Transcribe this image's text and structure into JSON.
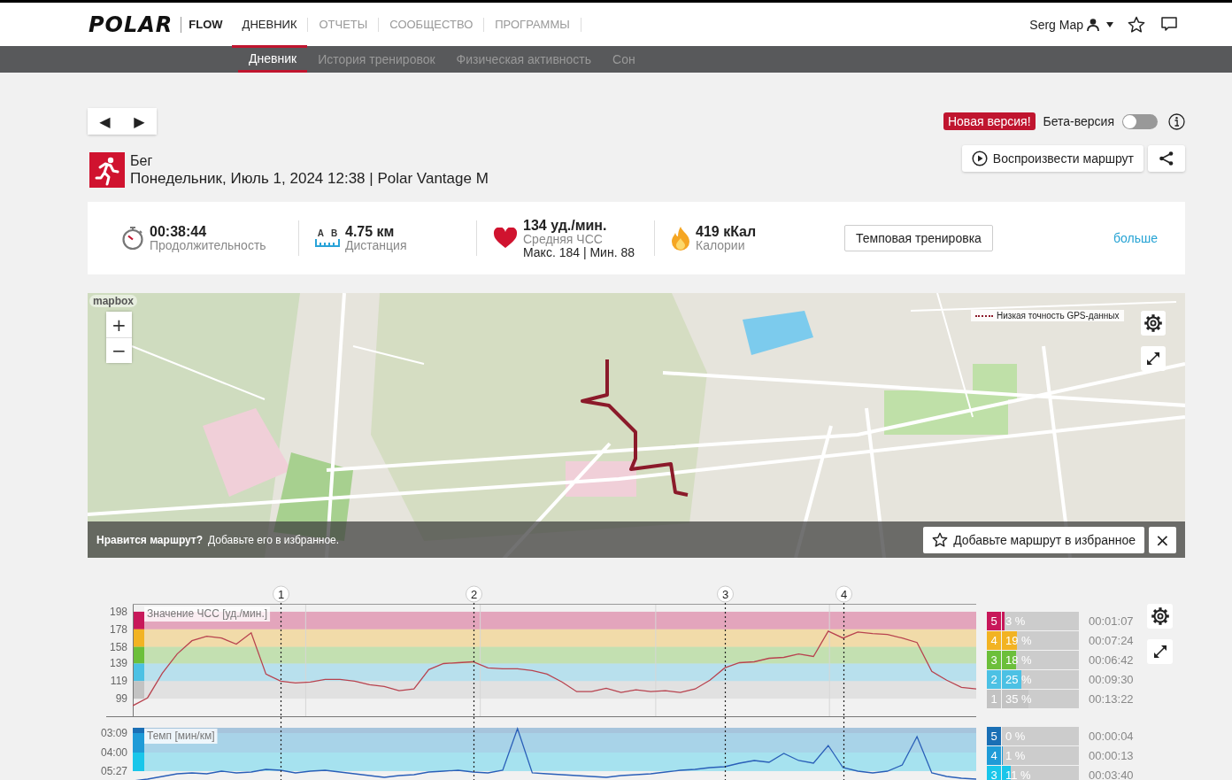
{
  "header": {
    "logo": "POLAR",
    "product": "FLOW",
    "nav": [
      {
        "label": "ДНЕВНИК",
        "selected": true
      },
      {
        "label": "ОТЧЕТЫ",
        "selected": false
      },
      {
        "label": "СООБЩЕСТВО",
        "selected": false
      },
      {
        "label": "ПРОГРАММЫ",
        "selected": false
      }
    ],
    "user": "Serg Map"
  },
  "subnav": [
    {
      "label": "Дневник",
      "selected": true
    },
    {
      "label": "История тренировок",
      "selected": false
    },
    {
      "label": "Физическая активность",
      "selected": false
    },
    {
      "label": "Сон",
      "selected": false
    }
  ],
  "toolbar": {
    "prev": "◀",
    "next": "▶",
    "badge": "Новая версия!",
    "beta": {
      "label": "Бета-версия",
      "on": false
    }
  },
  "activity": {
    "sport": "Бег",
    "datetime": "Понедельник, Июль 1, 2024 12:38 | Polar Vantage M",
    "buttons": [
      {
        "kind": "play",
        "label": "Воспроизвести маршрут"
      },
      {
        "kind": "share"
      }
    ]
  },
  "summary": {
    "stats": [
      {
        "kind": "duration",
        "value": "00:38:44",
        "label": "Продолжительность"
      },
      {
        "kind": "distance",
        "icon_letters": [
          "A",
          "B"
        ],
        "value": "4.75 км",
        "label": "Дистанция"
      },
      {
        "kind": "heart_rate",
        "value": "134 уд./мин.",
        "label": "Средняя ЧСС",
        "detail": "Макс. 184 | Мин. 88"
      },
      {
        "kind": "calories",
        "value": "419 кКал",
        "label": "Калории"
      }
    ],
    "training_type": "Темповая тренировка",
    "more_link": "больше"
  },
  "map": {
    "attribution": "mapbox",
    "zoom_in": "+",
    "zoom_out": "−",
    "gps_legend": "Низкая точность GPS-данных",
    "prompt": {
      "question": "Нравится маршрут?",
      "text": "Добавьте его в избранное."
    },
    "favorite_button": "Добавьте маршрут в избранное",
    "close": "×"
  },
  "charts": [
    {
      "title": "Значение ЧСС [уд./мин.]",
      "chart_data": {
        "type": "line",
        "grid": true,
        "ylim": [
          78,
          207
        ],
        "yticks": [
          198,
          178,
          158,
          139,
          119,
          99
        ],
        "bands": [
          {
            "axis": "y",
            "from": 178,
            "to": 198,
            "color": "#c8185a"
          },
          {
            "axis": "y",
            "from": 158,
            "to": 178,
            "color": "#f2b323"
          },
          {
            "axis": "y",
            "from": 139,
            "to": 158,
            "color": "#6cbf3a"
          },
          {
            "axis": "y",
            "from": 119,
            "to": 139,
            "color": "#4cc1e4"
          },
          {
            "axis": "y",
            "from": 99,
            "to": 119,
            "color": "#c3c3c3"
          }
        ],
        "categories": [
          null,
          null,
          null,
          null,
          null,
          null,
          null,
          null,
          null,
          null,
          "1",
          null,
          null,
          null,
          null,
          null,
          null,
          null,
          null,
          null,
          null,
          null,
          null,
          "2",
          null,
          null,
          null,
          null,
          null,
          null,
          null,
          null,
          null,
          null,
          null,
          null,
          null,
          null,
          null,
          null,
          "3",
          null,
          null,
          null,
          null,
          null,
          null,
          null,
          "4",
          null,
          null,
          null,
          null,
          null,
          null,
          null,
          null,
          null
        ],
        "series": [
          {
            "color": "#b8434f",
            "values": [
              91,
              100,
              128,
              150,
              165,
              170,
              168,
              161,
              174,
              127,
              119,
              117,
              118,
              121,
              121,
              119,
              115,
              113,
              108,
              110,
              132,
              139,
              140,
              141,
              134,
              133,
              133,
              131,
              127,
              118,
              107,
              107,
              111,
              106,
              109,
              107,
              108,
              106,
              110,
              120,
              134,
              140,
              141,
              145,
              146,
              150,
              147,
              176,
              168,
              175,
              173,
              172,
              168,
              163,
              130,
              120,
              112,
              110
            ]
          }
        ]
      },
      "zones": [
        {
          "number": "5",
          "percent": "3 %",
          "time": "00:01:07",
          "color": "#c8185a",
          "level": 0.03
        },
        {
          "number": "4",
          "percent": "19 %",
          "time": "00:07:24",
          "color": "#f2b323",
          "level": 0.19
        },
        {
          "number": "3",
          "percent": "18 %",
          "time": "00:06:42",
          "color": "#6cbf3a",
          "level": 0.18
        },
        {
          "number": "2",
          "percent": "25 %",
          "time": "00:09:30",
          "color": "#4cc1e4",
          "level": 0.25
        },
        {
          "number": "1",
          "percent": "35 %",
          "time": "00:13:22",
          "color": "#c3c3c3",
          "level": 0.35
        }
      ]
    },
    {
      "title": "Темп [мин/км]",
      "axis_labels": [
        "03:09",
        "04:00",
        "05:27"
      ],
      "zones": [
        {
          "number": "5",
          "percent": "0 %",
          "time": "00:00:04",
          "color": "#1a6fb5",
          "level": 0
        },
        {
          "number": "4",
          "percent": "1 %",
          "time": "00:00:13",
          "color": "#1f9bd7",
          "level": 0.01
        },
        {
          "number": "3",
          "percent": "11 %",
          "time": "00:03:40",
          "color": "#19c6ea",
          "level": 0.11
        }
      ]
    }
  ]
}
